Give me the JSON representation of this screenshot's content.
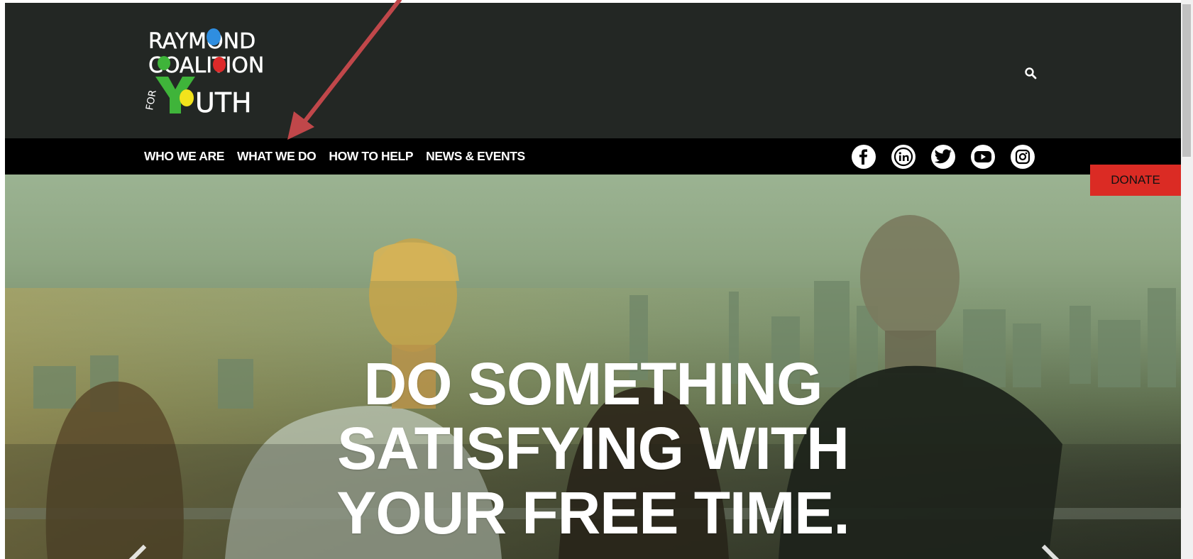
{
  "logo": {
    "line1": "RAYMOND",
    "line2": "COALITION",
    "line3_small": "FOR",
    "line3": "YOUTH"
  },
  "nav": {
    "items": [
      {
        "label": "WHO WE ARE"
      },
      {
        "label": "WHAT WE DO"
      },
      {
        "label": "HOW TO HELP"
      },
      {
        "label": "NEWS & EVENTS"
      }
    ]
  },
  "social": [
    "facebook-icon",
    "linkedin-icon",
    "twitter-icon",
    "youtube-icon",
    "instagram-icon"
  ],
  "donate": {
    "label": "DONATE"
  },
  "hero": {
    "line1": "DO SOMETHING",
    "line2": "SATISFYING WITH",
    "line3": "YOUR FREE TIME."
  },
  "colors": {
    "header_bg": "#232724",
    "nav_bg": "#000000",
    "donate_bg": "#db2b24",
    "annotation_arrow": "#c0474a"
  }
}
